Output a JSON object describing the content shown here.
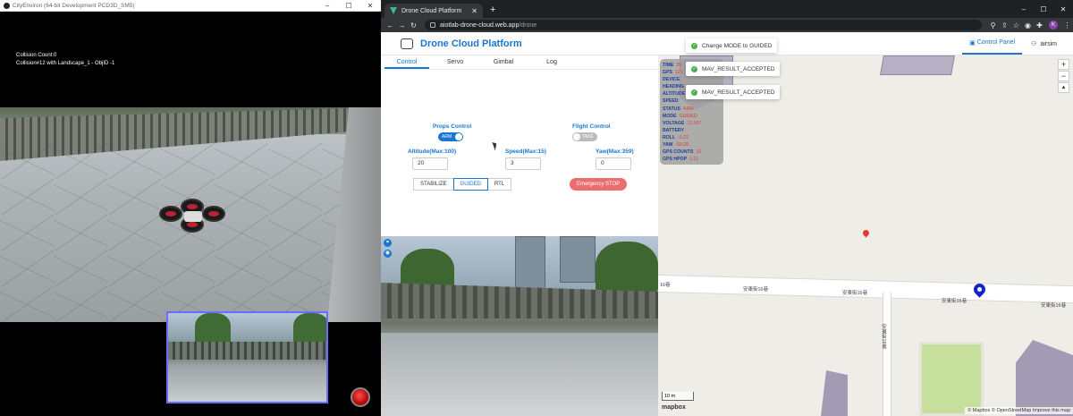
{
  "left_window": {
    "title": "CityEnviron (64-bit Development PCD3D_SM5)",
    "controls": [
      "–",
      "☐",
      "✕"
    ],
    "overlay": {
      "line1": "Collision Count:0",
      "line2": "Collision#12 with Landscape_1 - ObjID -1"
    }
  },
  "browser": {
    "tab_title": "Drone Cloud Platform",
    "new_tab": "+",
    "window_controls": [
      "–",
      "☐",
      "✕"
    ],
    "url_host": "aiotlab-drone-cloud.web.app",
    "url_path": "/drone",
    "profile_initial": "K"
  },
  "app": {
    "title": "Drone Cloud Platform",
    "nav_control_panel": "Control Panel",
    "nav_user": "airsim",
    "tabs": [
      "Control",
      "Servo",
      "Gimbal",
      "Log"
    ],
    "active_tab": "Control"
  },
  "control": {
    "props_label": "Props Control",
    "props_toggle": "ARM",
    "flight_label": "Flight Control",
    "flight_toggle": "TAKE OFF",
    "altitude_label": "Altitude(Max:100)",
    "altitude_value": "20",
    "speed_label": "Speed(Max:15)",
    "speed_value": "3",
    "yaw_label": "Yaw(Max:359)",
    "yaw_value": "0",
    "modes": [
      "STABILIZE",
      "GUIDED",
      "RTL"
    ],
    "active_mode": "GUIDED",
    "estop": "Emergency STOP"
  },
  "telemetry": [
    {
      "k": "TIME",
      "v": "20"
    },
    {
      "k": "GPS",
      "v": "121"
    },
    {
      "k": "DEVICE",
      "v": ""
    },
    {
      "k": "HEADING",
      "v": ""
    },
    {
      "k": "ALTITUDE",
      "v": ""
    },
    {
      "k": "SPEED",
      "v": ""
    },
    {
      "k": "STATUS",
      "v": "ARM"
    },
    {
      "k": "MODE",
      "v": "GUIDED"
    },
    {
      "k": "VOLTAGE",
      "v": "12.587"
    },
    {
      "k": "BATTERY",
      "v": ""
    },
    {
      "k": "ROLL",
      "v": "-0.22"
    },
    {
      "k": "YAW",
      "v": "-59.28"
    },
    {
      "k": "GPS COUNTS",
      "v": "10"
    },
    {
      "k": "GPS HPOP",
      "v": "1.21"
    }
  ],
  "toasts": [
    "Change MODE to GUIDED",
    "MAV_RESULT_ACCEPTED",
    "MAV_RESULT_ACCEPTED"
  ],
  "map": {
    "street_left": "16巷",
    "street_1": "安東街16巷",
    "street_2": "安東街16巷",
    "street_3": "安東街16巷",
    "street_4": "安東街16巷",
    "street_vertical": "安東街16巷",
    "zoom_in": "+",
    "zoom_out": "−",
    "compass": "▲",
    "scale": "10 m",
    "logo": "mapbox",
    "attribution": "© Mapbox © OpenStreetMap Improve this map"
  },
  "colors": {
    "primary": "#1976d2",
    "danger": "#ec6d6d",
    "telemetry_key": "#1d3ea0",
    "telemetry_value": "#e53935",
    "marker_blue": "#1226c9"
  }
}
